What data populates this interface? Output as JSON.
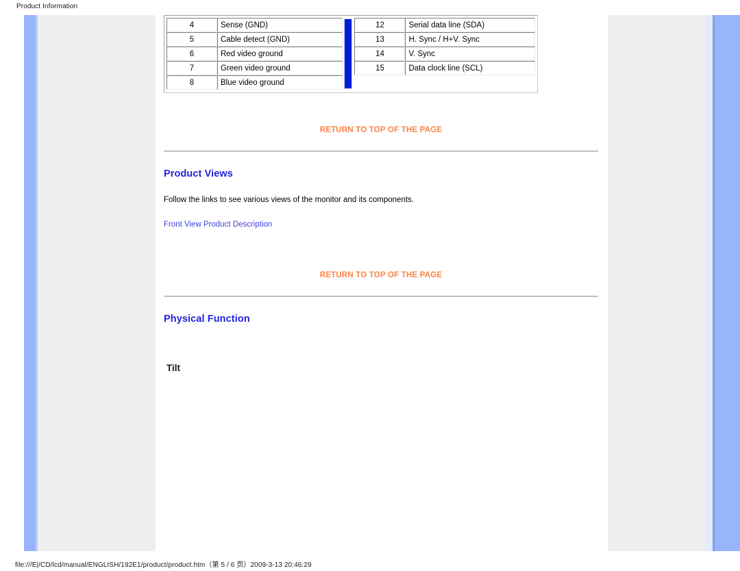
{
  "print_header": "Product Information",
  "print_footer": "file:///E|/CD/lcd/manual/ENGLISH/192E1/product/product.htm（第 5 / 6 页）2009-3-13 20:46:29",
  "colors": {
    "heading_blue": "#2222dd",
    "link_blue": "#4040e0",
    "return_orange": "#ff8040",
    "divider_blue": "#0020d8",
    "rail_blue": "#98b4fa",
    "panel_gray": "#efefef"
  },
  "pin_table": {
    "left_column": [
      {
        "pin": "4",
        "signal": "Sense (GND)"
      },
      {
        "pin": "5",
        "signal": "Cable detect (GND)"
      },
      {
        "pin": "6",
        "signal": "Red video ground"
      },
      {
        "pin": "7",
        "signal": "Green video ground"
      },
      {
        "pin": "8",
        "signal": "Blue video ground"
      }
    ],
    "right_column": [
      {
        "pin": "12",
        "signal": "Serial data line (SDA)"
      },
      {
        "pin": "13",
        "signal": "H. Sync / H+V. Sync"
      },
      {
        "pin": "14",
        "signal": "V. Sync"
      },
      {
        "pin": "15",
        "signal": "Data clock line (SCL)"
      }
    ]
  },
  "return_top_1": "RETURN TO TOP OF THE PAGE",
  "return_top_2": "RETURN TO TOP OF THE PAGE",
  "product_views": {
    "heading": "Product Views",
    "paragraph": "Follow the links to see various views of the monitor and its components.",
    "link": "Front View Product Description"
  },
  "physical_function": {
    "heading": "Physical Function",
    "subheading": "Tilt"
  }
}
